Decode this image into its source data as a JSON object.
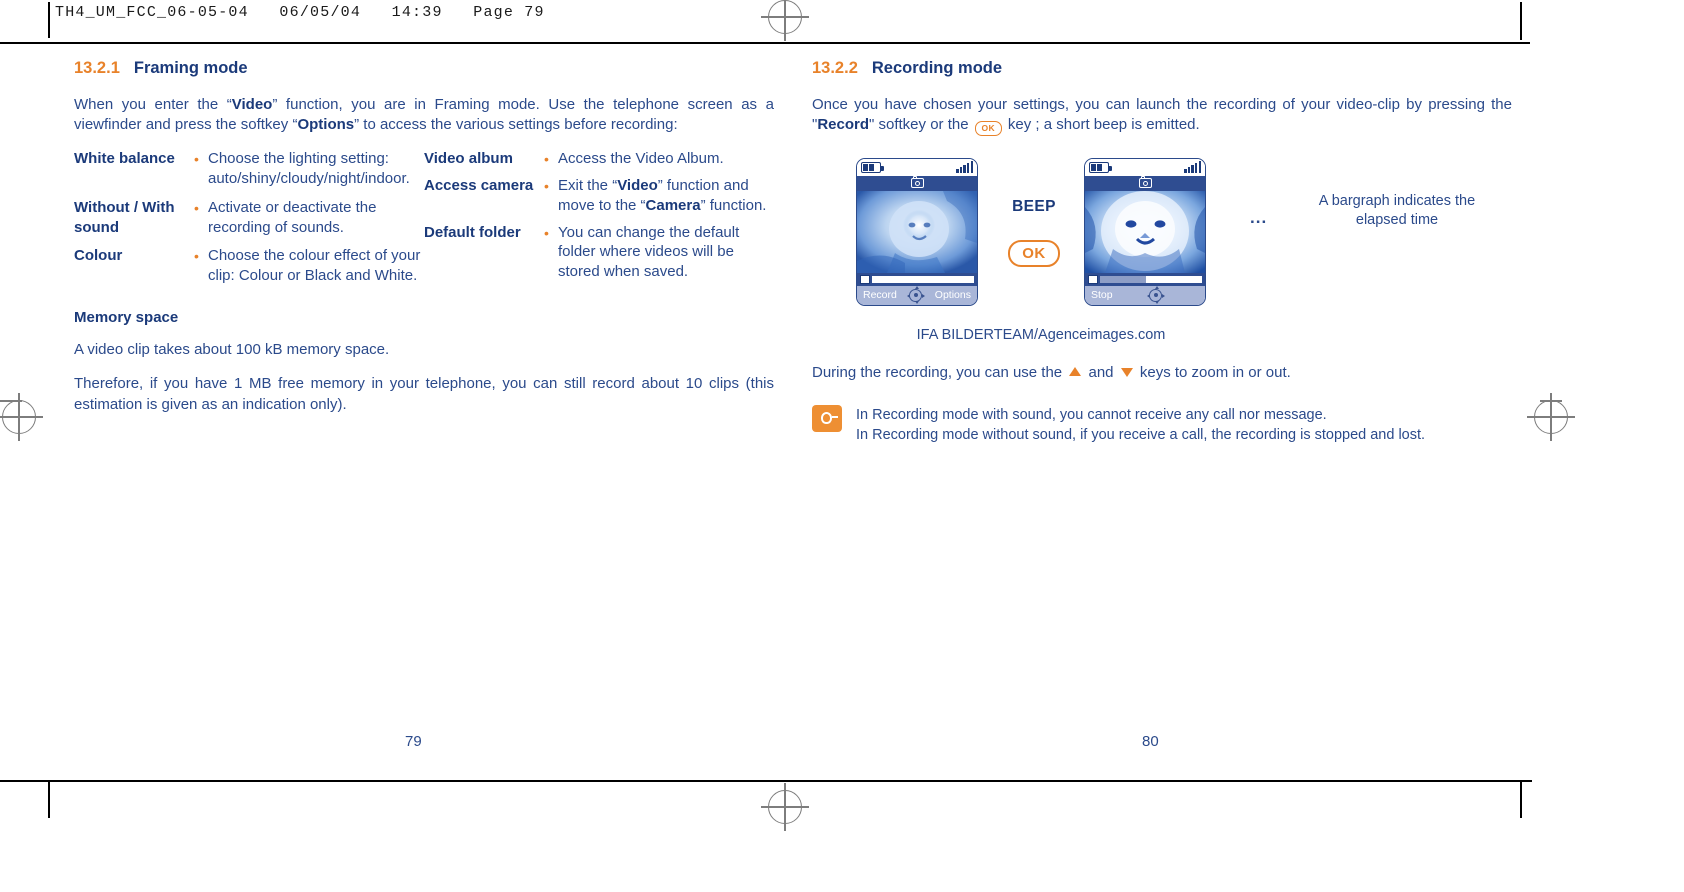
{
  "print_header": "TH4_UM_FCC_06-05-04   06/05/04   14:39   Page 79",
  "left_page": {
    "section": {
      "number": "13.2.1",
      "title": "Framing mode"
    },
    "intro_part1": "When you enter the “",
    "intro_bold1": "Video",
    "intro_part2": "” function, you are in Framing mode. Use the telephone screen as a viewfinder and press the softkey “",
    "intro_bold2": "Options",
    "intro_part3": "” to access the various settings before recording:",
    "options_left": [
      {
        "key": "White balance",
        "bullet": "•",
        "value": "Choose the lighting setting: auto/shiny/cloudy/night/indoor."
      },
      {
        "key": "Without / With sound",
        "bullet": "•",
        "value": "Activate or deactivate the recording of sounds."
      },
      {
        "key": "Colour",
        "bullet": "•",
        "value": "Choose the colour effect of your clip: Colour or Black and White."
      }
    ],
    "options_right": [
      {
        "key": "Video album",
        "bullet": "•",
        "value": "Access the Video Album."
      },
      {
        "key": "Access camera",
        "bullet": "•",
        "value_part1": "Exit the “",
        "value_bold1": "Video",
        "value_part2": "” function and move to the “",
        "value_bold2": "Camera",
        "value_part3": "” function."
      },
      {
        "key": "Default folder",
        "bullet": "•",
        "value": "You can change the default folder where videos will be stored when saved."
      }
    ],
    "memory_heading": "Memory space",
    "memory_p1": "A video clip takes about 100 kB memory space.",
    "memory_p2": "Therefore, if you have 1 MB free memory in your telephone, you can still record about 10 clips (this estimation is given as an indication only).",
    "page_number": "79"
  },
  "right_page": {
    "section": {
      "number": "13.2.2",
      "title": "Recording mode"
    },
    "intro_part1": "Once you have chosen your settings, you can launch the recording of your video-clip by pressing the \"",
    "intro_bold1": "Record",
    "intro_part2": "\" softkey or the",
    "ok_glyph": "OK",
    "intro_part3": "key ; a short beep is emitted.",
    "phone1": {
      "softkey_left": "Record",
      "softkey_right": "Options",
      "navpad_icon": "navigation-pad-icon",
      "battery_icon": "battery-icon",
      "signal_icon": "signal-bars-icon",
      "camera_icon": "camera-icon",
      "bargraph_fill_percent": 0
    },
    "phone2": {
      "softkey_left": "Stop",
      "softkey_right": "",
      "navpad_icon": "navigation-pad-icon",
      "battery_icon": "battery-icon",
      "signal_icon": "signal-bars-icon",
      "camera_icon": "camera-icon",
      "bargraph_fill_percent": 55
    },
    "beep_label": "BEEP",
    "ok_button_label": "OK",
    "ellipsis": "...",
    "bargraph_note": "A bargraph indicates the elapsed time",
    "photo_credit": "IFA BILDERTEAM/Agenceimages.com",
    "zoom_text_part1": "During the recording, you can use the",
    "zoom_text_and": "and",
    "zoom_text_part2": "keys to zoom in or out.",
    "note_icon": "lightbulb-tip-icon",
    "note_line1": "In Recording mode with sound, you cannot receive any call nor message.",
    "note_line2": "In Recording mode without sound, if you receive a call, the recording is stopped and lost.",
    "page_number": "80"
  },
  "colors": {
    "body_blue": "#2b4a8b",
    "heading_blue": "#1b3a7a",
    "accent_orange": "#e8822a",
    "phone_titlebar": "#2f4d91",
    "phone_softbar": "#a9b6d8"
  }
}
